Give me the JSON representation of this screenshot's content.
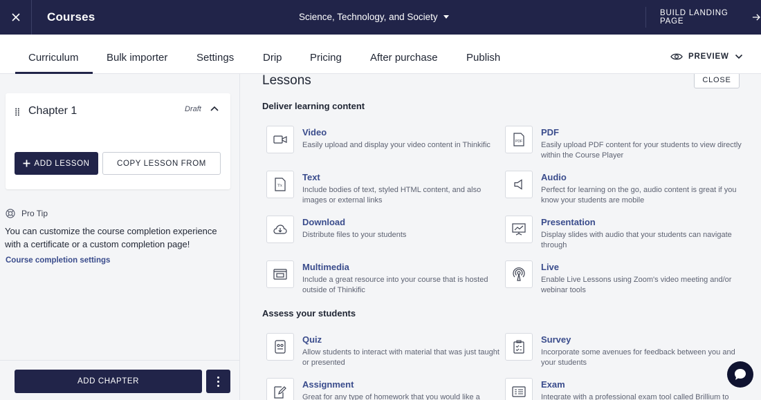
{
  "topbar": {
    "title": "Courses",
    "course_name": "Science, Technology, and Society",
    "build_landing_label": "BUILD LANDING PAGE"
  },
  "tabs": [
    {
      "label": "Curriculum",
      "active": true
    },
    {
      "label": "Bulk importer"
    },
    {
      "label": "Settings"
    },
    {
      "label": "Drip"
    },
    {
      "label": "Pricing"
    },
    {
      "label": "After purchase"
    },
    {
      "label": "Publish"
    }
  ],
  "preview_label": "PREVIEW",
  "chapter": {
    "title": "Chapter 1",
    "status": "Draft",
    "add_lesson_label": "ADD LESSON",
    "copy_lesson_label": "COPY LESSON FROM"
  },
  "pro_tip": {
    "heading": "Pro Tip",
    "body": "You can customize the course completion experience with a certificate or a custom completion page!",
    "link": "Course completion settings"
  },
  "footer": {
    "add_chapter_label": "ADD CHAPTER"
  },
  "lessons_panel": {
    "title": "Lessons",
    "close_label": "CLOSE",
    "deliver_heading": "Deliver learning content",
    "assess_heading": "Assess your students",
    "deliver_items": [
      {
        "name": "Video",
        "desc": "Easily upload and display your video content in Thinkific",
        "icon": "video-icon"
      },
      {
        "name": "PDF",
        "desc": "Easily upload PDF content for your students to view directly within the Course Player",
        "icon": "pdf-icon"
      },
      {
        "name": "Text",
        "desc": "Include bodies of text, styled HTML content, and also images or external links",
        "icon": "text-icon"
      },
      {
        "name": "Audio",
        "desc": "Perfect for learning on the go, audio content is great if you know your students are mobile",
        "icon": "audio-icon"
      },
      {
        "name": "Download",
        "desc": "Distribute files to your students",
        "icon": "download-icon"
      },
      {
        "name": "Presentation",
        "desc": "Display slides with audio that your students can navigate through",
        "icon": "presentation-icon"
      },
      {
        "name": "Multimedia",
        "desc": "Include a great resource into your course that is hosted outside of Thinkific",
        "icon": "multimedia-icon"
      },
      {
        "name": "Live",
        "desc": "Enable Live Lessons using Zoom's video meeting and/or webinar tools",
        "icon": "live-icon"
      }
    ],
    "assess_items": [
      {
        "name": "Quiz",
        "desc": "Allow students to interact with material that was just taught or presented",
        "icon": "quiz-icon"
      },
      {
        "name": "Survey",
        "desc": "Incorporate some avenues for feedback between you and your students",
        "icon": "survey-icon"
      },
      {
        "name": "Assignment",
        "desc": "Great for any type of homework that you would like a",
        "icon": "assignment-icon"
      },
      {
        "name": "Exam",
        "desc": "Integrate with a professional exam tool called Brillium to",
        "icon": "exam-icon"
      }
    ]
  },
  "icon_labels": {
    "pdf": "PDF",
    "text": "Tx"
  },
  "colors": {
    "topbar": "#212449",
    "accent_link": "#3a4c8c",
    "background": "#f4f5f7"
  }
}
